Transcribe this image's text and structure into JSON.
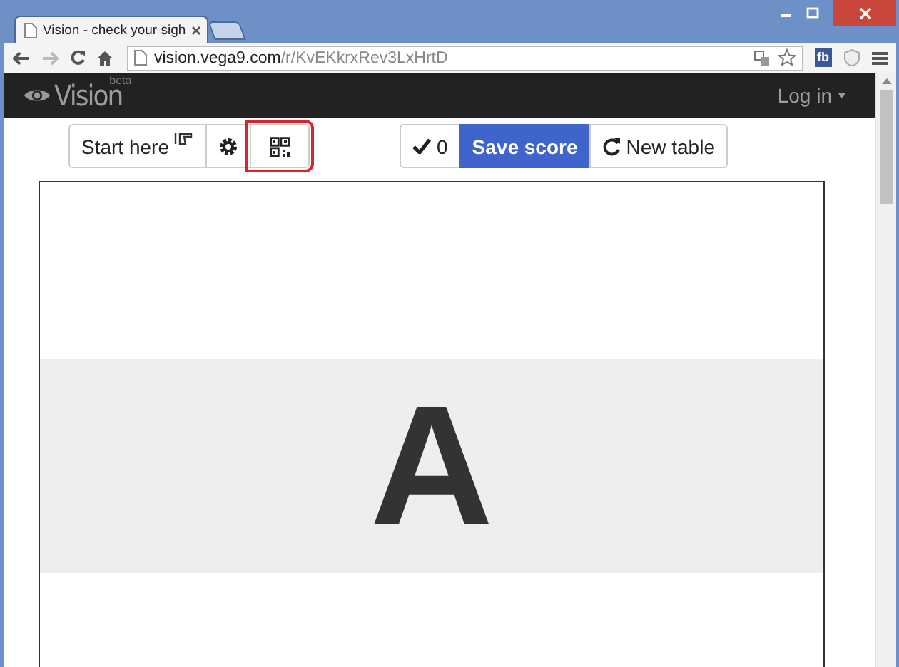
{
  "browser": {
    "tabs": [
      {
        "title": "Vision - check your sigh",
        "selected": true
      },
      {
        "kind": "new-tab",
        "selected": false
      }
    ],
    "address": {
      "host": "vision.vega9.com",
      "path": "/r/KvEKkrxRev3LxHrtD"
    },
    "extension": "fb"
  },
  "navbar": {
    "brand": "Vision",
    "badge": "beta",
    "login": "Log in"
  },
  "toolbar": [
    {
      "kind": "text",
      "label": "Start here",
      "highlighted": false
    },
    {
      "kind": "settings",
      "highlighted": false
    },
    {
      "kind": "qr",
      "highlighted": true
    }
  ],
  "actions": [
    {
      "kind": "check",
      "label": "0"
    },
    {
      "kind": "primary",
      "label": "Save score"
    },
    {
      "kind": "reload",
      "label": "New table"
    }
  ],
  "chart": {
    "letter": "A"
  }
}
